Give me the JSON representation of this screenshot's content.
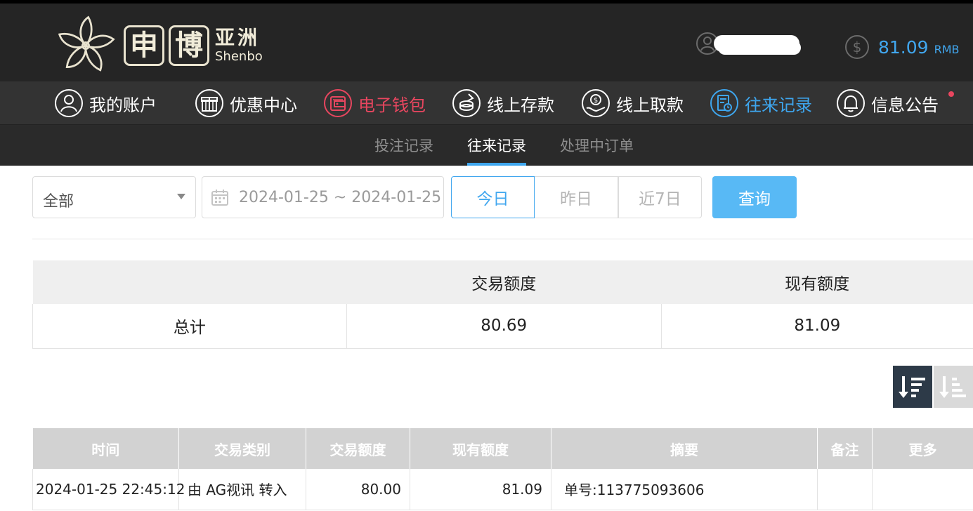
{
  "brand": {
    "glyph1": "申",
    "glyph2": "博",
    "name_cn": "亚洲",
    "name_en": "Shenbo"
  },
  "account": {
    "balance": "81.09",
    "currency": "RMB"
  },
  "nav": {
    "items": [
      {
        "label": "我的账户",
        "icon": "user-circle-icon"
      },
      {
        "label": "优惠中心",
        "icon": "gift-icon"
      },
      {
        "label": "电子钱包",
        "icon": "wallet-icon"
      },
      {
        "label": "线上存款",
        "icon": "deposit-icon"
      },
      {
        "label": "线上取款",
        "icon": "withdraw-icon"
      },
      {
        "label": "往来记录",
        "icon": "records-icon"
      },
      {
        "label": "信息公告",
        "icon": "bell-icon"
      }
    ]
  },
  "subnav": {
    "bets": "投注记录",
    "transactions": "往来记录",
    "pending": "处理中订单"
  },
  "filter": {
    "category": "全部",
    "date_range": "2024-01-25 ~ 2024-01-25",
    "today": "今日",
    "yesterday": "昨日",
    "last7": "近7日",
    "query": "查询"
  },
  "summary": {
    "headers": [
      "",
      "交易额度",
      "现有额度"
    ],
    "row": {
      "label": "总计",
      "trade_amount": "80.69",
      "balance": "81.09"
    }
  },
  "records": {
    "headers": [
      "时间",
      "交易类别",
      "交易额度",
      "现有额度",
      "摘要",
      "备注",
      "更多"
    ],
    "rows": [
      {
        "time": "2024-01-25 22:45:12",
        "type": "由 AG视讯 转入",
        "amount": "80.00",
        "balance": "81.09",
        "summary": "单号:113775093606",
        "remark": "",
        "more": ""
      }
    ]
  },
  "colors": {
    "accent": "#41a7ef",
    "alert": "#e8465f",
    "header_bg": "#252525",
    "nav_bg": "#333333"
  }
}
